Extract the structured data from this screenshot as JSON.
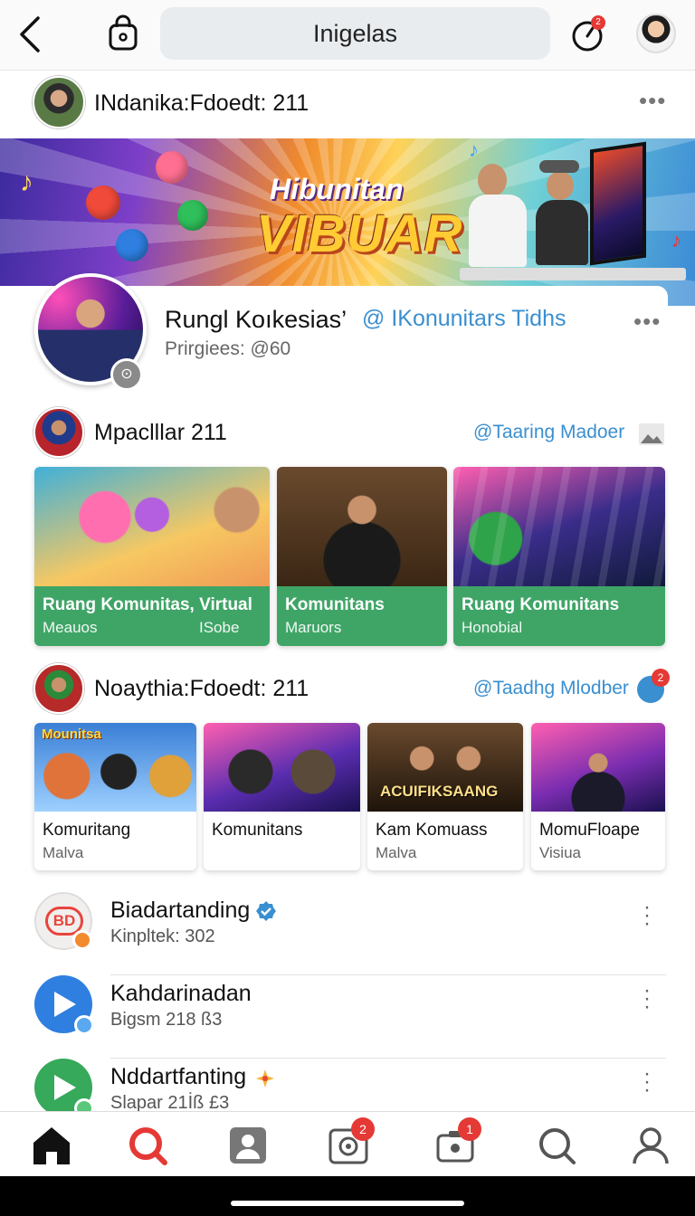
{
  "topbar": {
    "search_text": "Inigelas",
    "timer_badge": "2"
  },
  "post": {
    "author": "INdanika:Fdoedt: 211"
  },
  "banner": {
    "line1": "Hibunitan",
    "line2": "VIBUAR"
  },
  "community": {
    "title": "Rungl Koıkesias’",
    "handle": "@ IKonunitars Tidhs",
    "members": "Prirgiees: @60"
  },
  "section1": {
    "name": "Mpaclllar 211",
    "tag": "@Taaring Madoer",
    "cards": [
      {
        "title": "Ruang Komunitas,  Virtual",
        "sub": "Meauos",
        "sub2": "ISobe"
      },
      {
        "title": "Komunitans",
        "sub": "Maruors"
      },
      {
        "title": "Ruang Komunitans",
        "sub": "Honobial"
      }
    ]
  },
  "section2": {
    "name": "Noaythia:Fdoedt: 211",
    "tag": "@Taadhg Mlodber",
    "badge": "2",
    "poster_title": "Mounitsa",
    "poster_title2": "ACUIFIKSAANG",
    "cards": [
      {
        "title": "Komuritang",
        "sub": "Malva"
      },
      {
        "title": "Komunitans",
        "sub": ""
      },
      {
        "title": "Kam Komuass",
        "sub": "Malva"
      },
      {
        "title": "MomuFloape",
        "sub": "Visiua"
      }
    ]
  },
  "list": [
    {
      "name": "Biadartanding",
      "sub": "Kinpltek: 302",
      "icon": "bd-logo-icon",
      "icon_text": "BD",
      "verified": true
    },
    {
      "name": "Kahdarinadan",
      "sub": "Bigsm 218 ß3",
      "icon": "play-icon"
    },
    {
      "name": "Nddartfanting",
      "sub": "Slapar 21İß £3",
      "icon": "play-icon",
      "sparkle": true
    }
  ],
  "nav": {
    "settings_badge": "2",
    "camera_badge": "1"
  },
  "colors": {
    "accent_blue": "#3a8fd0",
    "card_green": "#3fa567",
    "badge_red": "#e53935"
  }
}
